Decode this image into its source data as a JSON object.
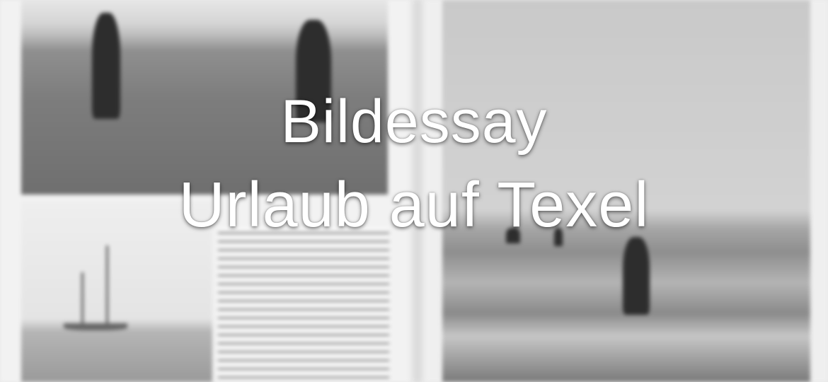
{
  "title": {
    "line1": "Bildessay",
    "line2": "Urlaub auf Texel"
  },
  "background": {
    "description_icons": [
      "photo-two-walkers",
      "photo-sailboat",
      "handwritten-text-page",
      "photo-beach-walker"
    ]
  }
}
